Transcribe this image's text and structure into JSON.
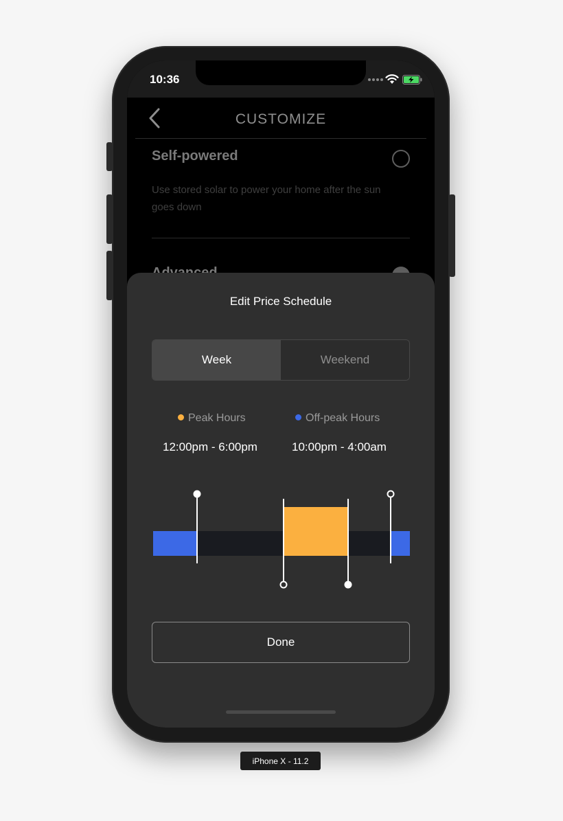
{
  "status_bar": {
    "time": "10:36"
  },
  "nav": {
    "title": "CUSTOMIZE"
  },
  "options": [
    {
      "title": "Self-powered",
      "description": "Use stored solar to power your home after the sun goes down",
      "selected": false
    },
    {
      "title": "Advanced",
      "selected": true
    }
  ],
  "sheet": {
    "title": "Edit Price Schedule",
    "tabs": [
      {
        "label": "Week",
        "active": true
      },
      {
        "label": "Weekend",
        "active": false
      }
    ],
    "legend": {
      "peak": {
        "label": "Peak Hours",
        "range": "12:00pm - 6:00pm",
        "color": "#FBB040"
      },
      "offpeak": {
        "label": "Off-peak Hours",
        "range": "10:00pm - 4:00am",
        "color": "#3C69E6"
      }
    },
    "timeline": {
      "track_color": "#191B20",
      "off_peak_color": "#3C69E6",
      "peak_color": "#FBB040",
      "peak_hours": [
        12,
        18
      ],
      "off_peak_hours": [
        22,
        4
      ]
    },
    "done_label": "Done"
  },
  "device_label": "iPhone X - 11.2"
}
